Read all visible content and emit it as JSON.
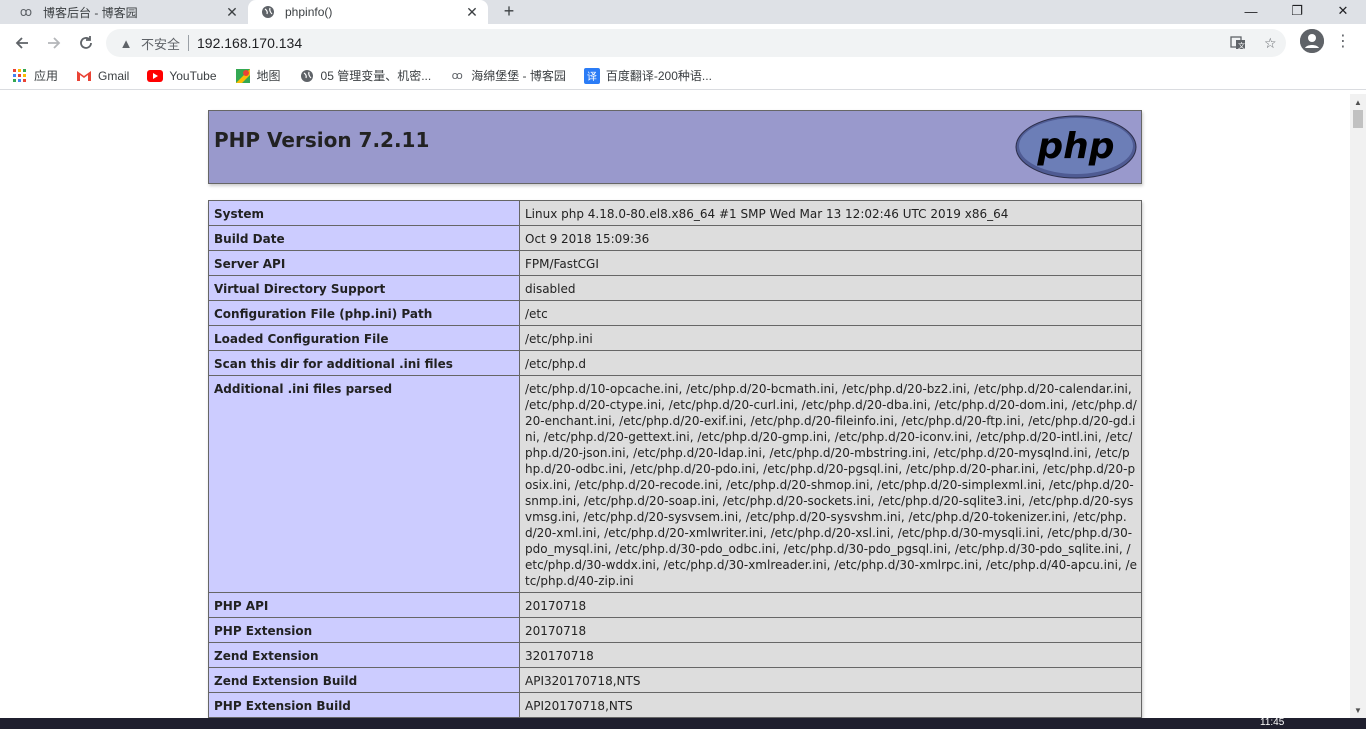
{
  "tabs": [
    {
      "title": "博客后台 - 博客园",
      "icon": "cnblogs-icon"
    },
    {
      "title": "phpinfo()",
      "icon": "globe-icon"
    }
  ],
  "toolbar": {
    "insecure_label": "不安全",
    "url": "192.168.170.134"
  },
  "bookmarks": [
    {
      "label": "应用",
      "icon": "apps-grid-icon"
    },
    {
      "label": "Gmail",
      "icon": "gmail-icon"
    },
    {
      "label": "YouTube",
      "icon": "youtube-icon"
    },
    {
      "label": "地图",
      "icon": "maps-icon"
    },
    {
      "label": "05 管理变量、机密...",
      "icon": "globe-icon"
    },
    {
      "label": "海绵堡堡 - 博客园",
      "icon": "cnblogs-icon"
    },
    {
      "label": "百度翻译-200种语...",
      "icon": "baidu-translate-icon"
    }
  ],
  "php": {
    "version_title": "PHP Version 7.2.11",
    "logo_text": "php",
    "rows": [
      {
        "name": "System",
        "value": "Linux php 4.18.0-80.el8.x86_64 #1 SMP Wed Mar 13 12:02:46 UTC 2019 x86_64"
      },
      {
        "name": "Build Date",
        "value": "Oct 9 2018 15:09:36"
      },
      {
        "name": "Server API",
        "value": "FPM/FastCGI"
      },
      {
        "name": "Virtual Directory Support",
        "value": "disabled"
      },
      {
        "name": "Configuration File (php.ini) Path",
        "value": "/etc"
      },
      {
        "name": "Loaded Configuration File",
        "value": "/etc/php.ini"
      },
      {
        "name": "Scan this dir for additional .ini files",
        "value": "/etc/php.d"
      },
      {
        "name": "Additional .ini files parsed",
        "value": "/etc/php.d/10-opcache.ini, /etc/php.d/20-bcmath.ini, /etc/php.d/20-bz2.ini, /etc/php.d/20-calendar.ini, /etc/php.d/20-ctype.ini, /etc/php.d/20-curl.ini, /etc/php.d/20-dba.ini, /etc/php.d/20-dom.ini, /etc/php.d/20-enchant.ini, /etc/php.d/20-exif.ini, /etc/php.d/20-fileinfo.ini, /etc/php.d/20-ftp.ini, /etc/php.d/20-gd.ini, /etc/php.d/20-gettext.ini, /etc/php.d/20-gmp.ini, /etc/php.d/20-iconv.ini, /etc/php.d/20-intl.ini, /etc/php.d/20-json.ini, /etc/php.d/20-ldap.ini, /etc/php.d/20-mbstring.ini, /etc/php.d/20-mysqlnd.ini, /etc/php.d/20-odbc.ini, /etc/php.d/20-pdo.ini, /etc/php.d/20-pgsql.ini, /etc/php.d/20-phar.ini, /etc/php.d/20-posix.ini, /etc/php.d/20-recode.ini, /etc/php.d/20-shmop.ini, /etc/php.d/20-simplexml.ini, /etc/php.d/20-snmp.ini, /etc/php.d/20-soap.ini, /etc/php.d/20-sockets.ini, /etc/php.d/20-sqlite3.ini, /etc/php.d/20-sysvmsg.ini, /etc/php.d/20-sysvsem.ini, /etc/php.d/20-sysvshm.ini, /etc/php.d/20-tokenizer.ini, /etc/php.d/20-xml.ini, /etc/php.d/20-xmlwriter.ini, /etc/php.d/20-xsl.ini, /etc/php.d/30-mysqli.ini, /etc/php.d/30-pdo_mysql.ini, /etc/php.d/30-pdo_odbc.ini, /etc/php.d/30-pdo_pgsql.ini, /etc/php.d/30-pdo_sqlite.ini, /etc/php.d/30-wddx.ini, /etc/php.d/30-xmlreader.ini, /etc/php.d/30-xmlrpc.ini, /etc/php.d/40-apcu.ini, /etc/php.d/40-zip.ini"
      },
      {
        "name": "PHP API",
        "value": "20170718"
      },
      {
        "name": "PHP Extension",
        "value": "20170718"
      },
      {
        "name": "Zend Extension",
        "value": "320170718"
      },
      {
        "name": "Zend Extension Build",
        "value": "API320170718,NTS"
      },
      {
        "name": "PHP Extension Build",
        "value": "API20170718,NTS"
      }
    ]
  },
  "taskbar": {
    "clock": "11:45"
  },
  "colors": {
    "php_header_bg": "#9999cc",
    "php_label_bg": "#ccccff",
    "php_value_bg": "#dddddd",
    "php_logo_bg": "#6c7eb7"
  }
}
